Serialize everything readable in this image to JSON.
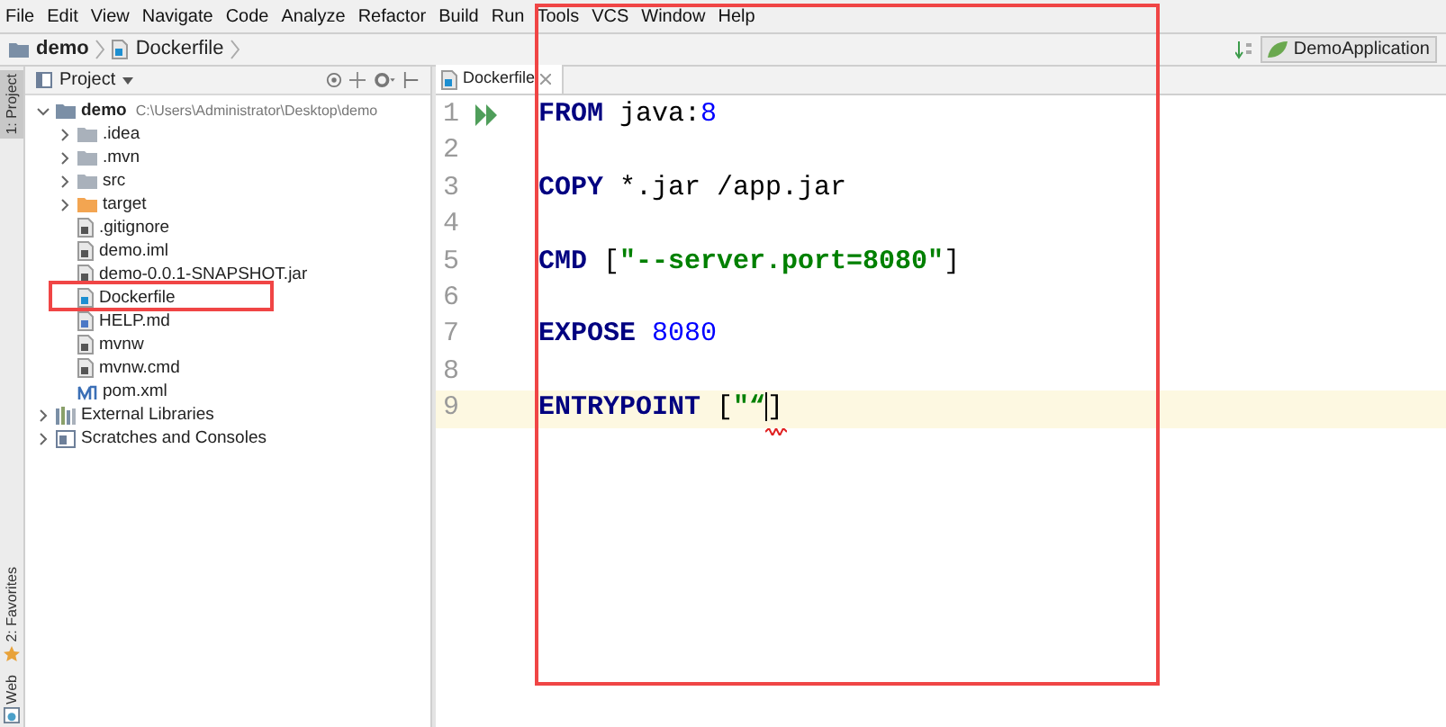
{
  "menu": [
    "File",
    "Edit",
    "View",
    "Navigate",
    "Code",
    "Analyze",
    "Refactor",
    "Build",
    "Run",
    "Tools",
    "VCS",
    "Window",
    "Help"
  ],
  "breadcrumb": [
    "demo",
    "Dockerfile"
  ],
  "run_config": "DemoApplication",
  "tool_windows": [
    {
      "label": "1: Project",
      "kind": "project",
      "selected": true
    },
    {
      "label": "2: Favorites",
      "kind": "favorites",
      "selected": false
    },
    {
      "label": "Web",
      "kind": "web",
      "selected": false
    }
  ],
  "project_panel": {
    "title": "Project",
    "tree": [
      {
        "name": "demo",
        "path": "C:\\Users\\Administrator\\Desktop\\demo",
        "kind": "module",
        "expanded": true,
        "marked": false,
        "children": [
          {
            "name": ".idea",
            "kind": "folder",
            "expanded": false,
            "marked": false
          },
          {
            "name": ".mvn",
            "kind": "folder",
            "expanded": false,
            "marked": false
          },
          {
            "name": "src",
            "kind": "folder",
            "expanded": false,
            "marked": false
          },
          {
            "name": "target",
            "kind": "excluded",
            "expanded": false,
            "marked": false
          },
          {
            "name": ".gitignore",
            "kind": "file",
            "marked": false
          },
          {
            "name": "demo.iml",
            "kind": "file",
            "marked": false
          },
          {
            "name": "demo-0.0.1-SNAPSHOT.jar",
            "kind": "file",
            "marked": false
          },
          {
            "name": "Dockerfile",
            "kind": "docker",
            "marked": true
          },
          {
            "name": "HELP.md",
            "kind": "markdown",
            "marked": false
          },
          {
            "name": "mvnw",
            "kind": "file",
            "marked": false
          },
          {
            "name": "mvnw.cmd",
            "kind": "file",
            "marked": false
          },
          {
            "name": "pom.xml",
            "kind": "maven",
            "marked": false
          }
        ]
      },
      {
        "name": "External Libraries",
        "kind": "libraries",
        "expanded": false,
        "marked": false
      },
      {
        "name": "Scratches and Consoles",
        "kind": "scratches",
        "expanded": false,
        "marked": false
      }
    ]
  },
  "editor": {
    "marked": true,
    "tabs": [
      {
        "label": "Dockerfile",
        "selected": true
      }
    ],
    "lines": [
      {
        "number": "1",
        "run": true,
        "current": false,
        "tokens": [
          {
            "kind": "keyword",
            "text": "FROM"
          },
          {
            "kind": "plain",
            "text": " java:"
          },
          {
            "kind": "number",
            "text": "8"
          }
        ]
      },
      {
        "number": "2",
        "run": false,
        "current": false
      },
      {
        "number": "3",
        "run": false,
        "current": false,
        "tokens": [
          {
            "kind": "keyword",
            "text": "COPY"
          },
          {
            "kind": "plain",
            "text": " *.jar /app.jar"
          }
        ]
      },
      {
        "number": "4",
        "run": false,
        "current": false
      },
      {
        "number": "5",
        "run": false,
        "current": false,
        "tokens": [
          {
            "kind": "keyword",
            "text": "CMD"
          },
          {
            "kind": "plain",
            "text": " ["
          },
          {
            "kind": "string",
            "text": "\"--server.port=8080\""
          },
          {
            "kind": "plain",
            "text": "]"
          }
        ]
      },
      {
        "number": "6",
        "run": false,
        "current": false
      },
      {
        "number": "7",
        "run": false,
        "current": false,
        "tokens": [
          {
            "kind": "keyword",
            "text": "EXPOSE"
          },
          {
            "kind": "number",
            "text": "8080"
          }
        ]
      },
      {
        "number": "8",
        "run": false,
        "current": false
      },
      {
        "number": "9",
        "run": false,
        "current": true,
        "tokens": [
          {
            "kind": "keyword",
            "text": "ENTRYPOINT"
          },
          {
            "kind": "plain",
            "text": " ["
          },
          {
            "kind": "string",
            "text": "\"“"
          },
          {
            "kind": "caret",
            "text": "]"
          }
        ]
      }
    ]
  }
}
